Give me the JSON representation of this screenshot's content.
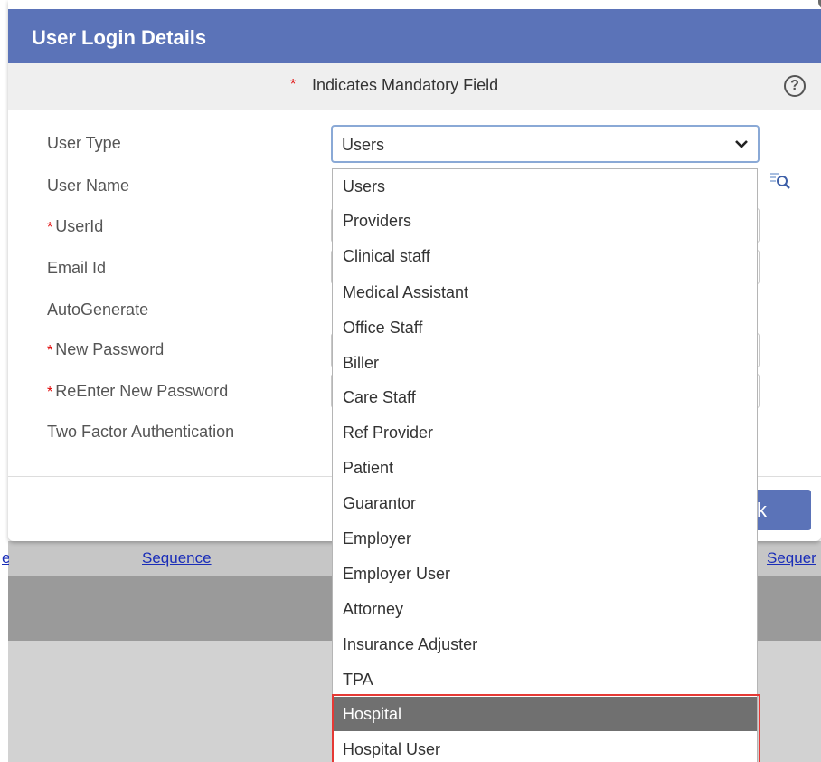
{
  "modal": {
    "title": "User Login Details",
    "mandatory_star": "*",
    "mandatory_text": "Indicates Mandatory Field",
    "help_glyph": "?",
    "ok_label": "k"
  },
  "form": {
    "required_star": "*",
    "labels": {
      "user_type": "User Type",
      "user_name": "User Name",
      "user_id": "UserId",
      "email_id": "Email Id",
      "auto_generate": "AutoGenerate",
      "new_password": "New Password",
      "reenter_password": "ReEnter New Password",
      "two_factor": "Two Factor Authentication"
    },
    "user_type_value": "Users"
  },
  "dropdown": {
    "options": [
      "Users",
      "Providers",
      "Clinical staff",
      "Medical Assistant",
      "Office Staff",
      "Biller",
      "Care Staff",
      "Ref Provider",
      "Patient",
      "Guarantor",
      "Employer",
      "Employer User",
      "Attorney",
      "Insurance Adjuster",
      "TPA",
      "Hospital",
      "Hospital User"
    ],
    "highlighted_option": "Hospital"
  },
  "background": {
    "link_left_stub": "e",
    "link_sequence_1": "Sequence",
    "link_sequence_2": "Sequer"
  },
  "icons": {
    "help": "help-icon",
    "dropdown_arrow": "chevron-down-icon",
    "lookup": "search-icon"
  },
  "colors": {
    "header_bg": "#5b73b8",
    "required": "#e00000",
    "highlight_border": "#e53935",
    "selected_option_bg": "#707070"
  }
}
